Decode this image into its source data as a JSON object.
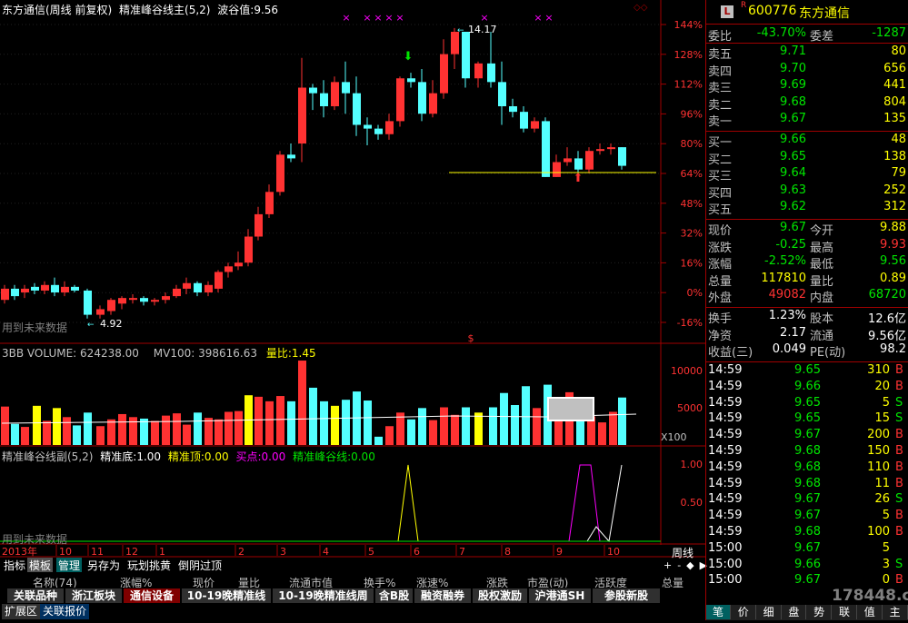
{
  "main_header": {
    "title": "东方通信(周线 前复权)",
    "indicator": "精准峰谷线主(5,2)",
    "wave_label": "波谷值:",
    "wave_value": "9.56"
  },
  "volume_header": {
    "name": "3BB VOLUME:",
    "volume": "624238.00",
    "mv": "MV100: 398616.63",
    "qty_label": "量比:",
    "qty_value": "1.45"
  },
  "sub_header": {
    "name": "精准峰谷线副(5,2)",
    "bottom_label": "精准底:",
    "bottom_value": "1.00",
    "top_label": "精准顶:",
    "top_value": "0.00",
    "buy_label": "买点:",
    "buy_value": "0.00",
    "line_label": "精准峰谷线:",
    "line_value": "0.00"
  },
  "annotations": {
    "future_data": "用到未来数据",
    "future_data_sub": "用到未来数据",
    "low_mark": "4.92",
    "high_mark": "14.17",
    "x100": "X100",
    "dollar": "$",
    "r_mark": "R"
  },
  "price_axis": [
    "144%",
    "128%",
    "112%",
    "96%",
    "80%",
    "64%",
    "48%",
    "32%",
    "16%",
    "0%",
    "-16%"
  ],
  "volume_axis": [
    "10000",
    "5000"
  ],
  "sub_axis": [
    "1.00",
    "0.50"
  ],
  "time_axis": {
    "year": "2013年",
    "months": [
      "10",
      "11",
      "12",
      "1",
      "2",
      "3",
      "4",
      "5",
      "6",
      "7",
      "8",
      "9",
      "10"
    ],
    "period": "周线"
  },
  "menu": [
    "指标",
    "模板",
    "管理",
    "另存为",
    "玩划挑黄",
    "倒阴过顶"
  ],
  "columns": [
    "名称(74)",
    "涨幅%",
    "现价",
    "量比",
    "流通市值",
    "换手%",
    "涨速%",
    "涨跌",
    "市盈(动)",
    "活跃度",
    "总量"
  ],
  "tabs": [
    "关联品种",
    "浙江板块",
    "通信设备",
    "10-19晚精准线",
    "10-19晚精准线周",
    "含B股",
    "融资融券",
    "股权激励",
    "沪港通SH",
    "参股新股"
  ],
  "bottom_tabs": [
    "扩展区",
    "关联报价"
  ],
  "right_panel": {
    "code": "600776",
    "name": "东方通信",
    "weibi": {
      "label": "委比",
      "value": "-43.70%",
      "label2": "委差",
      "value2": "-1287"
    },
    "sells": [
      {
        "label": "卖五",
        "price": "9.71",
        "vol": "80"
      },
      {
        "label": "卖四",
        "price": "9.70",
        "vol": "656"
      },
      {
        "label": "卖三",
        "price": "9.69",
        "vol": "441"
      },
      {
        "label": "卖二",
        "price": "9.68",
        "vol": "804"
      },
      {
        "label": "卖一",
        "price": "9.67",
        "vol": "135"
      }
    ],
    "buys": [
      {
        "label": "买一",
        "price": "9.66",
        "vol": "48"
      },
      {
        "label": "买二",
        "price": "9.65",
        "vol": "138"
      },
      {
        "label": "买三",
        "price": "9.64",
        "vol": "79"
      },
      {
        "label": "买四",
        "price": "9.63",
        "vol": "252"
      },
      {
        "label": "买五",
        "price": "9.62",
        "vol": "312"
      }
    ],
    "stats": [
      {
        "l1": "现价",
        "v1": "9.67",
        "l2": "今开",
        "v2": "9.88"
      },
      {
        "l1": "涨跌",
        "v1": "-0.25",
        "l2": "最高",
        "v2": "9.93"
      },
      {
        "l1": "涨幅",
        "v1": "-2.52%",
        "l2": "最低",
        "v2": "9.56"
      },
      {
        "l1": "总量",
        "v1": "117810",
        "l2": "量比",
        "v2": "0.89"
      },
      {
        "l1": "外盘",
        "v1": "49082",
        "l2": "内盘",
        "v2": "68720"
      }
    ],
    "stats2": [
      {
        "l1": "换手",
        "v1": "1.23%",
        "l2": "股本",
        "v2": "12.6亿"
      },
      {
        "l1": "净资",
        "v1": "2.17",
        "l2": "流通",
        "v2": "9.56亿"
      },
      {
        "l1": "收益(三)",
        "v1": "0.049",
        "l2": "PE(动)",
        "v2": "98.2"
      }
    ],
    "ticks": [
      {
        "t": "14:59",
        "p": "9.65",
        "v": "310",
        "s": "B"
      },
      {
        "t": "14:59",
        "p": "9.66",
        "v": "20",
        "s": "B"
      },
      {
        "t": "14:59",
        "p": "9.65",
        "v": "5",
        "s": "S"
      },
      {
        "t": "14:59",
        "p": "9.65",
        "v": "15",
        "s": "S"
      },
      {
        "t": "14:59",
        "p": "9.67",
        "v": "200",
        "s": "B"
      },
      {
        "t": "14:59",
        "p": "9.68",
        "v": "150",
        "s": "B"
      },
      {
        "t": "14:59",
        "p": "9.68",
        "v": "110",
        "s": "B"
      },
      {
        "t": "14:59",
        "p": "9.68",
        "v": "11",
        "s": "B"
      },
      {
        "t": "14:59",
        "p": "9.67",
        "v": "26",
        "s": "S"
      },
      {
        "t": "14:59",
        "p": "9.67",
        "v": "5",
        "s": "B"
      },
      {
        "t": "14:59",
        "p": "9.68",
        "v": "100",
        "s": "B"
      },
      {
        "t": "15:00",
        "p": "9.67",
        "v": "5",
        "s": ""
      },
      {
        "t": "15:00",
        "p": "9.66",
        "v": "3",
        "s": "S"
      },
      {
        "t": "15:00",
        "p": "9.67",
        "v": "0",
        "s": "B"
      }
    ],
    "bottom_tabs": [
      "笔",
      "价",
      "细",
      "盘",
      "势",
      "联",
      "值",
      "主"
    ],
    "watermark": "178448.com"
  },
  "colors": {
    "up": "#ff3232",
    "down": "#54ffff",
    "green": "#00e600",
    "yellow": "#ffff00",
    "magenta": "#ff00ff",
    "red_border": "#a00000"
  }
}
